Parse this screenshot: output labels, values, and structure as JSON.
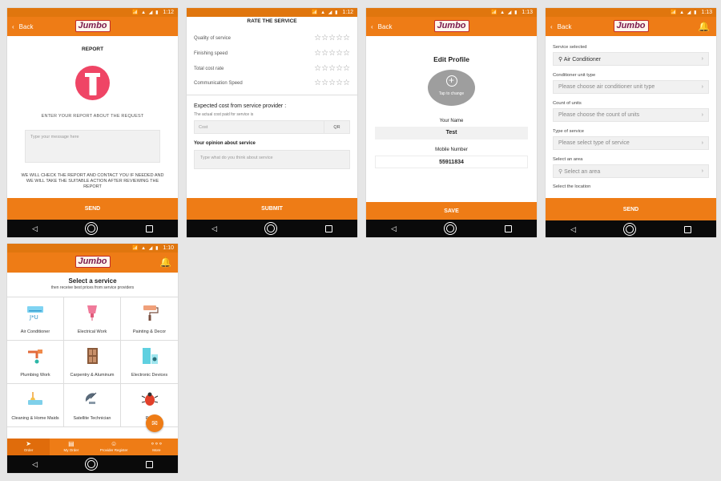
{
  "statusbar": {
    "times": [
      "1:12",
      "1:12",
      "1:13",
      "1:13",
      "1:10"
    ]
  },
  "brand": {
    "logo_text": "Jumbo"
  },
  "common": {
    "back_label": "Back"
  },
  "report": {
    "title": "REPORT",
    "subtitle": "ENTER YOUR REPORT ABOUT THE REQUEST",
    "message_placeholder": "Type your message here",
    "note": "WE WILL CHECK THE REPORT AND CONTACT YOU IF NEEDED AND WE WILL TAKE THE SUITABLE ACTION AFTER REVIEWING THE REPORT",
    "send_label": "SEND"
  },
  "rate": {
    "title": "RATE THE SERVICE",
    "criteria": [
      "Quality of service",
      "Finishing speed",
      "Total cost rate",
      "Communication Speed"
    ],
    "expected_title": "Expected cost from service provider :",
    "expected_sub": "The actual cost paid for service is",
    "cost_placeholder": "Cost",
    "currency": "QR",
    "opinion_title": "Your opinion about service",
    "opinion_placeholder": "Type what do you think about service",
    "submit_label": "SUBMIT"
  },
  "profile": {
    "title": "Edit Profile",
    "tap_label": "Tap to change",
    "name_label": "Your Name",
    "name_value": "Test",
    "mobile_label": "Mobile Number",
    "mobile_value": "55911834",
    "save_label": "SAVE"
  },
  "form": {
    "fields": [
      {
        "label": "Service selected",
        "value": "Air Conditioner",
        "filled": true,
        "icon": "wrench-icon"
      },
      {
        "label": "Conditioner unit type",
        "value": "Please choose air conditioner unit type",
        "filled": false
      },
      {
        "label": "Count of units",
        "value": "Please choose the count of units",
        "filled": false
      },
      {
        "label": "Type of service",
        "value": "Please select type of service",
        "filled": false
      },
      {
        "label": "Select an area",
        "value": "Select an area",
        "filled": false,
        "icon": "location-pin-icon"
      }
    ],
    "location_label": "Select the location",
    "send_label": "SEND"
  },
  "services": {
    "title": "Select a service",
    "subtitle": "then receive best prices from service providers",
    "items": [
      {
        "label": "Air Conditioner",
        "icon": "air-conditioner-icon"
      },
      {
        "label": "Electrical Work",
        "icon": "electrical-icon"
      },
      {
        "label": "Painting & Decor",
        "icon": "paint-roller-icon"
      },
      {
        "label": "Plumbing Work",
        "icon": "plumbing-icon"
      },
      {
        "label": "Carpentry & Aluminum",
        "icon": "door-icon"
      },
      {
        "label": "Electronic Devices",
        "icon": "appliances-icon"
      },
      {
        "label": "Cleaning & Home Maids",
        "icon": "cleaning-icon"
      },
      {
        "label": "Satellite Technician",
        "icon": "satellite-dish-icon"
      },
      {
        "label": "Pes",
        "icon": "pest-control-icon"
      }
    ],
    "tabs": [
      {
        "label": "Order",
        "icon": "send-icon"
      },
      {
        "label": "My Order",
        "icon": "orders-icon"
      },
      {
        "label": "Provider Register",
        "icon": "user-icon"
      },
      {
        "label": "More",
        "icon": "more-icon"
      }
    ]
  },
  "colors": {
    "accent": "#ee7c16",
    "navbar": "#0a0a0a",
    "report_icon": "#ef4565"
  }
}
